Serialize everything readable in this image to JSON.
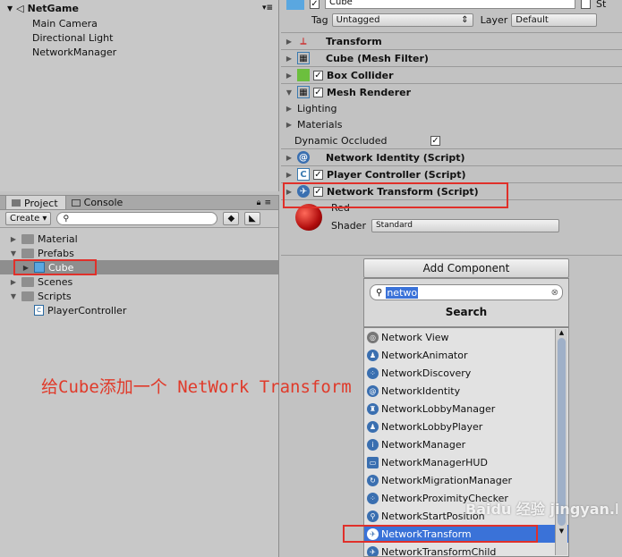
{
  "hierarchy": {
    "scene": "NetGame",
    "items": [
      "Main Camera",
      "Directional Light",
      "NetworkManager"
    ]
  },
  "project": {
    "tabs": [
      "Project",
      "Console"
    ],
    "create_label": "Create",
    "tree": [
      {
        "label": "Material"
      },
      {
        "label": "Prefabs"
      },
      {
        "label": "Cube"
      },
      {
        "label": "Scenes"
      },
      {
        "label": "Scripts"
      },
      {
        "label": "PlayerController"
      }
    ]
  },
  "inspector": {
    "object_name": "Cube",
    "static_label": "St",
    "tag_label": "Tag",
    "tag_value": "Untagged",
    "layer_label": "Layer",
    "layer_value": "Default",
    "components": [
      "Transform",
      "Cube (Mesh Filter)",
      "Box Collider",
      "Mesh Renderer",
      "Lighting",
      "Materials",
      "Dynamic Occluded",
      "Network Identity (Script)",
      "Player Controller (Script)",
      "Network Transform (Script)"
    ],
    "material_name": "Red",
    "shader_label": "Shader",
    "shader_value": "Standard"
  },
  "add_component": {
    "button_label": "Add Component",
    "search_value": "netwo",
    "search_title": "Search",
    "results": [
      "Network View",
      "NetworkAnimator",
      "NetworkDiscovery",
      "NetworkIdentity",
      "NetworkLobbyManager",
      "NetworkLobbyPlayer",
      "NetworkManager",
      "NetworkManagerHUD",
      "NetworkMigrationManager",
      "NetworkProximityChecker",
      "NetworkStartPosition",
      "NetworkTransform",
      "NetworkTransformChild"
    ]
  },
  "annotation": "给Cube添加一个 NetWork Transform",
  "watermark": "Baidu 经验 jingyan.baidu.com",
  "colors": {
    "annotation": "#e03a2a",
    "highlight_box": "#e0302a",
    "selection": "#3a72d8"
  }
}
